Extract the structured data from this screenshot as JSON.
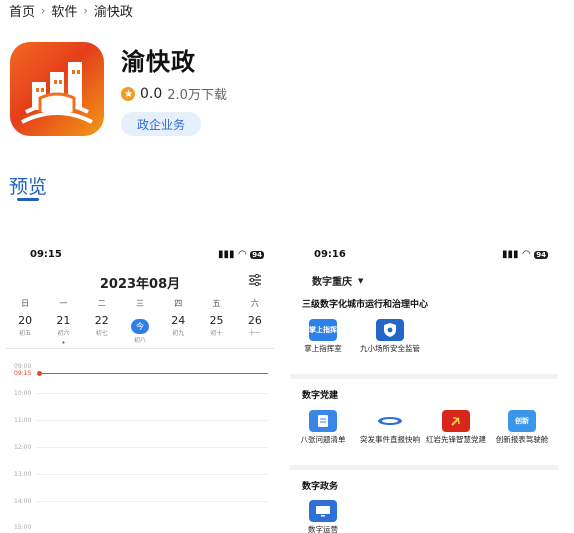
{
  "breadcrumb": {
    "home": "首页",
    "category": "软件",
    "current": "渝快政"
  },
  "app": {
    "name": "渝快政",
    "rating": "0.0",
    "downloads": "2.0万下载",
    "tag": "政企业务"
  },
  "preview": {
    "title": "预览"
  },
  "calendar_shot": {
    "time": "09:15",
    "battery": "94",
    "title": "2023年08月",
    "weekdays": [
      "日",
      "一",
      "二",
      "三",
      "四",
      "五",
      "六"
    ],
    "dates": [
      {
        "day": "20",
        "lunar": "初五"
      },
      {
        "day": "21",
        "lunar": "初六"
      },
      {
        "day": "22",
        "lunar": "初七"
      },
      {
        "day": "今",
        "lunar": "初八"
      },
      {
        "day": "24",
        "lunar": "初九"
      },
      {
        "day": "25",
        "lunar": "初十"
      },
      {
        "day": "26",
        "lunar": "十一"
      }
    ],
    "hours": [
      "09:00",
      "10:00",
      "11:00",
      "12:00",
      "13:00",
      "14:00",
      "15:00"
    ],
    "now_label": "09:15"
  },
  "apps_shot": {
    "time": "09:16",
    "battery": "94",
    "region": "数字重庆",
    "sections": [
      {
        "title": "三级数字化城市运行和治理中心",
        "items": [
          "掌上指挥室",
          "九小场所安全监管"
        ]
      },
      {
        "title": "数字党建",
        "items": [
          "八张问题清单",
          "突发事件直报快响",
          "红岩先锋智慧党建",
          "创新报表驾驶舱"
        ]
      },
      {
        "title": "数字政务",
        "items": [
          "数字运营"
        ]
      }
    ],
    "icon_texts": [
      "掌上指挥",
      "创新"
    ]
  },
  "colors": {
    "accent": "#1f5fbf",
    "tag_bg": "#e6f0fc",
    "icon_orange": "#f26a1f",
    "now_red": "#e5462d"
  }
}
